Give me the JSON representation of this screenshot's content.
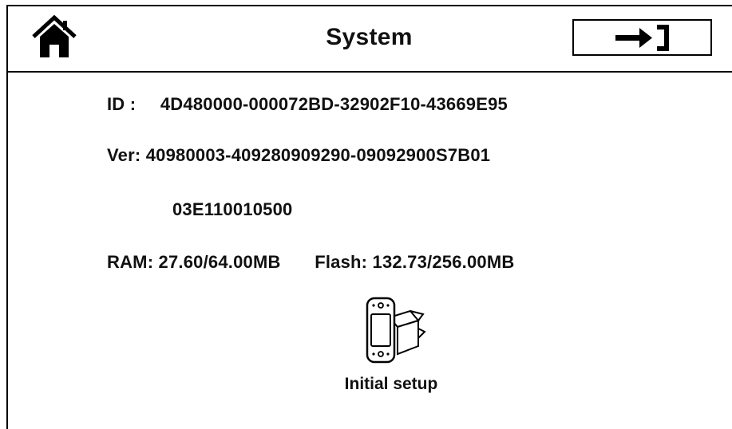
{
  "header": {
    "title": "System",
    "home_icon": "home-icon",
    "exit_icon": "exit-arrow-icon"
  },
  "info": {
    "id_label": "ID :",
    "id_value": "4D480000-000072BD-32902F10-43669E95",
    "ver_label": "Ver:",
    "ver_value_line1": "40980003-409280909290-09092900S7B01",
    "ver_value_line2": "03E110010500",
    "ram_label": "RAM:",
    "ram_value": "27.60/64.00MB",
    "flash_label": "Flash:",
    "flash_value": "132.73/256.00MB"
  },
  "setup": {
    "label": "Initial setup",
    "icon": "device-box-icon"
  }
}
